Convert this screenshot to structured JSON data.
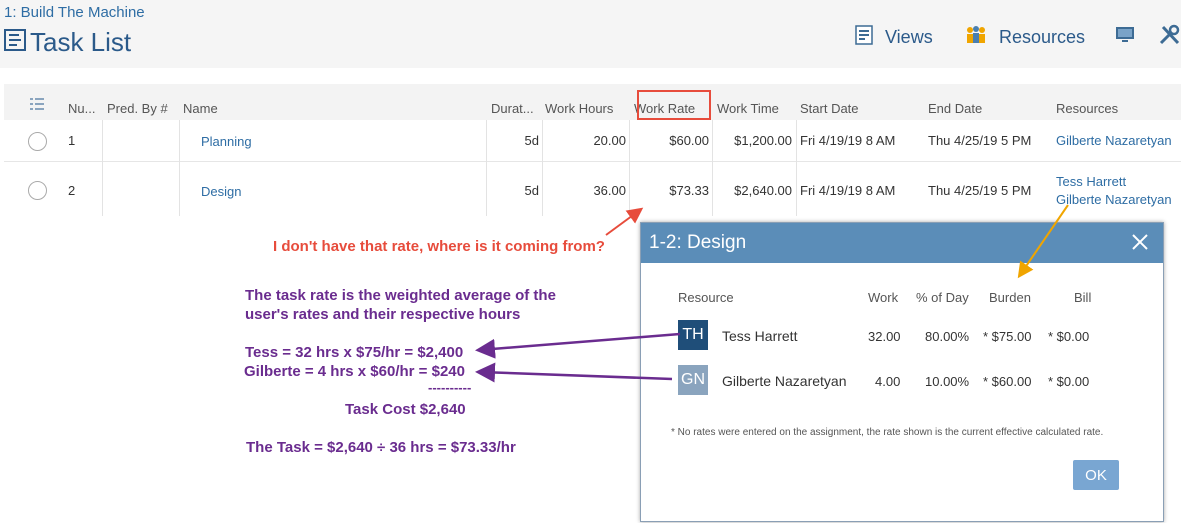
{
  "header": {
    "breadcrumb": "1: Build The Machine",
    "title": "Task List",
    "toolbar": {
      "views": "Views",
      "resources": "Resources"
    }
  },
  "grid": {
    "columns": [
      "Nu...",
      "Pred. By #",
      "Name",
      "Durat...",
      "Work Hours",
      "Work Rate",
      "Work Time",
      "Start Date",
      "End Date",
      "Resources"
    ],
    "rows": [
      {
        "num": "1",
        "pred": "",
        "name": "Planning",
        "duration": "5d",
        "work_hours": "20.00",
        "work_rate": "$60.00",
        "work_time": "$1,200.00",
        "start": "Fri 4/19/19 8 AM",
        "end": "Thu 4/25/19 5 PM",
        "resources": [
          "Gilberte Nazaretyan"
        ]
      },
      {
        "num": "2",
        "pred": "",
        "name": "Design",
        "duration": "5d",
        "work_hours": "36.00",
        "work_rate": "$73.33",
        "work_time": "$2,640.00",
        "start": "Fri 4/19/19 8 AM",
        "end": "Thu 4/25/19 5 PM",
        "resources": [
          "Tess Harrett",
          "Gilberte Nazaretyan"
        ]
      }
    ]
  },
  "annotations": {
    "question": "I don't have that rate, where is it coming from?",
    "explain_1": "The task rate is the weighted average of the",
    "explain_2": "user's rates and their respective hours",
    "tess_calc": "Tess = 32 hrs x $75/hr = $2,400",
    "gilberte_calc": "Gilberte = 4 hrs x $60/hr = $240",
    "divider": "----------",
    "task_cost": "Task Cost  $2,640",
    "task_rate": "The Task = $2,640 ÷ 36 hrs = $73.33/hr"
  },
  "dialog": {
    "title": "1-2: Design",
    "columns": {
      "resource": "Resource",
      "work": "Work",
      "pct_day": "% of Day",
      "burden": "Burden",
      "bill": "Bill"
    },
    "rows": [
      {
        "initials": "TH",
        "name": "Tess Harrett",
        "work": "32.00",
        "pct": "80.00%",
        "burden": "* $75.00",
        "bill": "* $0.00",
        "avatar_color": "#1f4e79"
      },
      {
        "initials": "GN",
        "name": "Gilberte Nazaretyan",
        "work": "4.00",
        "pct": "10.00%",
        "burden": "* $60.00",
        "bill": "* $0.00",
        "avatar_color": "#8aa4be"
      }
    ],
    "footnote": "* No rates were entered on the assignment, the rate shown is the current effective calculated rate.",
    "ok": "OK"
  },
  "colors": {
    "accent": "#5b8db8",
    "link": "#2e6da4",
    "annotation_red": "#e74c3c",
    "annotation_purple": "#6a2c8f",
    "arrow_orange": "#f0a500"
  }
}
